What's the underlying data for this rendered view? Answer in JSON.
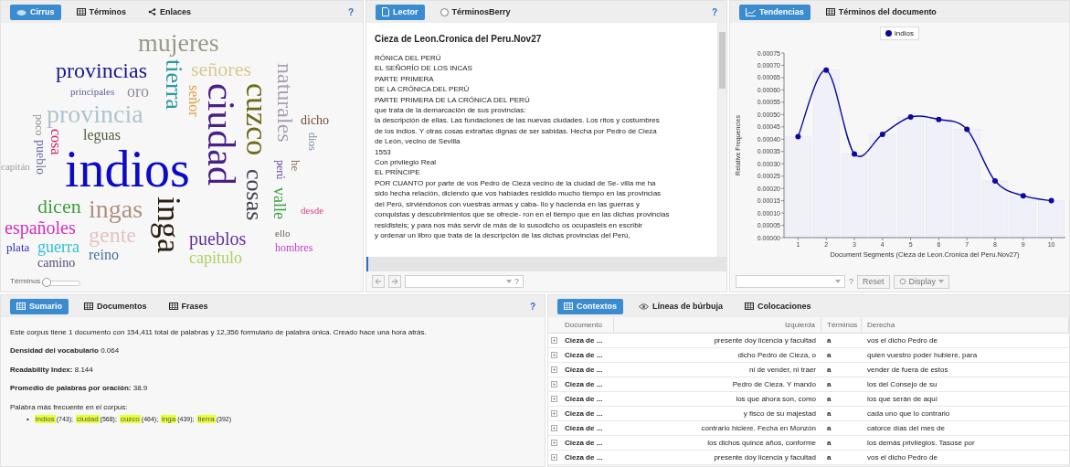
{
  "cirrus": {
    "tabs": [
      {
        "label": "Cirrus",
        "selected": true,
        "kind": "cloud"
      },
      {
        "label": "Términos",
        "selected": false,
        "kind": "table"
      },
      {
        "label": "Enlaces",
        "selected": false,
        "kind": "network"
      }
    ],
    "help": "?",
    "words": [
      {
        "text": "mujeres",
        "color": "#9a9a8a"
      },
      {
        "text": "provincias",
        "color": "#1a1a8c"
      },
      {
        "text": "tierra",
        "color": "#2a9a9a"
      },
      {
        "text": "señores",
        "color": "#d8c890"
      },
      {
        "text": "naturales",
        "color": "#a8a0b0"
      },
      {
        "text": "oro",
        "color": "#909098"
      },
      {
        "text": "ciudad",
        "color": "#4a2088"
      },
      {
        "text": "cuzco",
        "color": "#6b6b1a"
      },
      {
        "text": "señor",
        "color": "#e0a040"
      },
      {
        "text": "principales",
        "color": "#6060a0"
      },
      {
        "text": "provincia",
        "color": "#b0c4cc"
      },
      {
        "text": "poco",
        "color": "#909090"
      },
      {
        "text": "dicho",
        "color": "#705030"
      },
      {
        "text": "leguas",
        "color": "#506040"
      },
      {
        "text": "cosa",
        "color": "#d02060"
      },
      {
        "text": "dios",
        "color": "#8090a0"
      },
      {
        "text": "pueblo",
        "color": "#7070a0"
      },
      {
        "text": "capitán",
        "color": "#a0a0a0"
      },
      {
        "text": "indios",
        "color": "#0a0ac8"
      },
      {
        "text": "perú",
        "color": "#6040a0"
      },
      {
        "text": "he",
        "color": "#8a7050"
      },
      {
        "text": "cosas",
        "color": "#404050"
      },
      {
        "text": "valle",
        "color": "#40a040"
      },
      {
        "text": "dicen",
        "color": "#40a040"
      },
      {
        "text": "ingas",
        "color": "#b09080"
      },
      {
        "text": "inga",
        "color": "#2a2010"
      },
      {
        "text": "desde",
        "color": "#e04080"
      },
      {
        "text": "españoles",
        "color": "#d030c0"
      },
      {
        "text": "gente",
        "color": "#e4c4c4"
      },
      {
        "text": "pueblos",
        "color": "#6030a0"
      },
      {
        "text": "ello",
        "color": "#706050"
      },
      {
        "text": "plata",
        "color": "#3030c0"
      },
      {
        "text": "guerra",
        "color": "#30c0d0"
      },
      {
        "text": "camino",
        "color": "#505070"
      },
      {
        "text": "reino",
        "color": "#4070a0"
      },
      {
        "text": "capitulo",
        "color": "#b0d060"
      },
      {
        "text": "hombres",
        "color": "#c040d0"
      }
    ],
    "slider": {
      "label": "Términos",
      "level": 0.1
    }
  },
  "reader": {
    "tabs": [
      {
        "label": "Lector",
        "selected": true,
        "kind": "document"
      },
      {
        "label": "TérminosBerry",
        "selected": false,
        "kind": "radio"
      }
    ],
    "help": "?",
    "title": "Cieza de Leon.Cronica del Peru.Nov27",
    "lines": [
      "RÓNICA DEL PERÚ",
      "EL SEÑORÍO DE LOS INCAS",
      "PARTE PRIMERA",
      "DE LA CRÓNICA DEL PERÚ",
      "PARTE PRIMERA DE LA CRÓNICA DEL PERÚ",
      "que trata de la demarcación de sus provincias:",
      "la descripción de ellas. Las fundaciones de las nuevas ciudades. Los ritos y costumbres",
      "de los indios. Y otras cosas extrañas dignas de ser sabidas. Hecha por Pedro de Cieza",
      "de León, vecino de Sevilla",
      "1553",
      "Con privilegio Real",
      "EL PRÍNCIPE",
      "POR CUANTO por parte de vos Pedro de Cieza vecino de la ciudad de Se- villa me ha",
      "sido hecha relación, diciendo que vos habíades residido mucho tiempo en las provincias",
      "del Perú, sirviéndonos con vuestras armas y caba- llo y hacienda en las guerras y",
      "conquistas y descubrimientos que se ofrecie- ron en el tiempo que en las dichas provincias",
      "residisteis; y para nos más servir de más de lo susodicho os ocupasteis en escribir",
      "y ordenar un libro que trata de la descripción de las dichas provincias del Perú,"
    ],
    "search_help": "?"
  },
  "trends": {
    "tabs": [
      {
        "label": "Tendencias",
        "selected": true,
        "kind": "chart"
      },
      {
        "label": "Términos del documento",
        "selected": false,
        "kind": "table"
      }
    ],
    "chart_data": {
      "type": "line",
      "xlabel": "Document Segments (Cieza de Leon.Cronica del Peru.Nov27)",
      "ylabel": "Relative Frequencies",
      "x": [
        1,
        2,
        3,
        4,
        5,
        6,
        7,
        8,
        9,
        10
      ],
      "series": [
        {
          "name": "indios",
          "color": "#0a0aa0",
          "marker": "circle",
          "values": [
            0.00041,
            0.00068,
            0.00034,
            0.00042,
            0.00049,
            0.00048,
            0.00044,
            0.00023,
            0.00017,
            0.00015
          ]
        },
        {
          "type": "bar",
          "color": "#f0f0f8",
          "values": [
            0.00041,
            0.00068,
            0.00034,
            0.00042,
            0.00049,
            0.00048,
            0.00044,
            0.00023,
            0.00017,
            0.00015
          ]
        }
      ],
      "xlim": [
        0.5,
        10.5
      ],
      "ylim": [
        0,
        0.00075
      ],
      "yticks": [
        {
          "value": 0,
          "label": "0.00000"
        },
        {
          "value": 5e-05,
          "label": "0.00005"
        },
        {
          "value": 0.0001,
          "label": "0.00010"
        },
        {
          "value": 0.00015,
          "label": "0.00015"
        },
        {
          "value": 0.0002,
          "label": "0.00020"
        },
        {
          "value": 0.00025,
          "label": "0.00025"
        },
        {
          "value": 0.0003,
          "label": "0.00030"
        },
        {
          "value": 0.00035,
          "label": "0.00035"
        },
        {
          "value": 0.0004,
          "label": "0.00040"
        },
        {
          "value": 0.00045,
          "label": "0.00045"
        },
        {
          "value": 0.0005,
          "label": "0.00050"
        },
        {
          "value": 0.00055,
          "label": "0.00055"
        },
        {
          "value": 0.0006,
          "label": "0.00060"
        },
        {
          "value": 0.00065,
          "label": "0.00065"
        },
        {
          "value": 0.0007,
          "label": "0.00070"
        },
        {
          "value": 0.00075,
          "label": "0.00075"
        }
      ],
      "xticks": [
        1,
        2,
        3,
        4,
        5,
        6,
        7,
        8,
        9,
        10
      ]
    },
    "search_help": "?",
    "reset": "Reset",
    "display": "Display"
  },
  "summary": {
    "tabs": [
      {
        "label": "Sumario",
        "selected": true,
        "kind": "table"
      },
      {
        "label": "Documentos",
        "selected": false,
        "kind": "table"
      },
      {
        "label": "Frases",
        "selected": false,
        "kind": "table"
      }
    ],
    "help": "?",
    "intro": "Este corpus tiene 1 documento con 154,411 total de palabras y 12,356 formulario de palabra única. Creado hace una hora atrás.",
    "stats": [
      {
        "label": "Densidad del vocabulario",
        "value": "0.064"
      },
      {
        "label": "Readability Index:",
        "value": "8.144"
      },
      {
        "label": "Promedio de palabras por oración:",
        "value": "38.9"
      }
    ],
    "frequent_label": "Palabra más frecuente en el corpus:",
    "bullet": "•",
    "frequent": [
      {
        "word": "indios",
        "count": "(743);"
      },
      {
        "word": "ciudad",
        "count": "(568);"
      },
      {
        "word": "cuzco",
        "count": "(464);"
      },
      {
        "word": "inga",
        "count": "(439);"
      },
      {
        "word": "tierra",
        "count": "(392)"
      }
    ]
  },
  "contexts": {
    "tabs": [
      {
        "label": "Contextos",
        "selected": true,
        "kind": "table"
      },
      {
        "label": "Líneas de búrbuja",
        "selected": false,
        "kind": "eye"
      },
      {
        "label": "Colocaciones",
        "selected": false,
        "kind": "table"
      }
    ],
    "columns": [
      "Documento",
      "Izquierda",
      "Términos",
      "Derecha"
    ],
    "rows": [
      {
        "document": "Cieza de ...",
        "left": "presente doy licencia y facultad",
        "term": "a",
        "right": "vos el dicho Pedro de"
      },
      {
        "document": "Cieza de ...",
        "left": "dicho Pedro de Cieza, o",
        "term": "a",
        "right": "quien vuestro poder hubiere, para"
      },
      {
        "document": "Cieza de ...",
        "left": "ni de vender, ni traer",
        "term": "a",
        "right": "vender de fuera de estos"
      },
      {
        "document": "Cieza de ...",
        "left": "Pedro de Cieza. Y mando",
        "term": "a",
        "right": "los del Consejo de su"
      },
      {
        "document": "Cieza de ...",
        "left": "los que ahora son, como",
        "term": "a",
        "right": "los que serán de aquí"
      },
      {
        "document": "Cieza de ...",
        "left": "y fisco de su majestad",
        "term": "a",
        "right": "cada uno que lo contrario"
      },
      {
        "document": "Cieza de ...",
        "left": "contrario hiciere. Fecha en Monzón",
        "term": "a",
        "right": "catorce días del mes de"
      },
      {
        "document": "Cieza de ...",
        "left": "los dichos quince años, conforme",
        "term": "a",
        "right": "los demás privilegios. Tasose por"
      },
      {
        "document": "Cieza de ...",
        "left": "presente doy licencia y facultad",
        "term": "a",
        "right": "vos el dicho Pedro de"
      }
    ]
  }
}
